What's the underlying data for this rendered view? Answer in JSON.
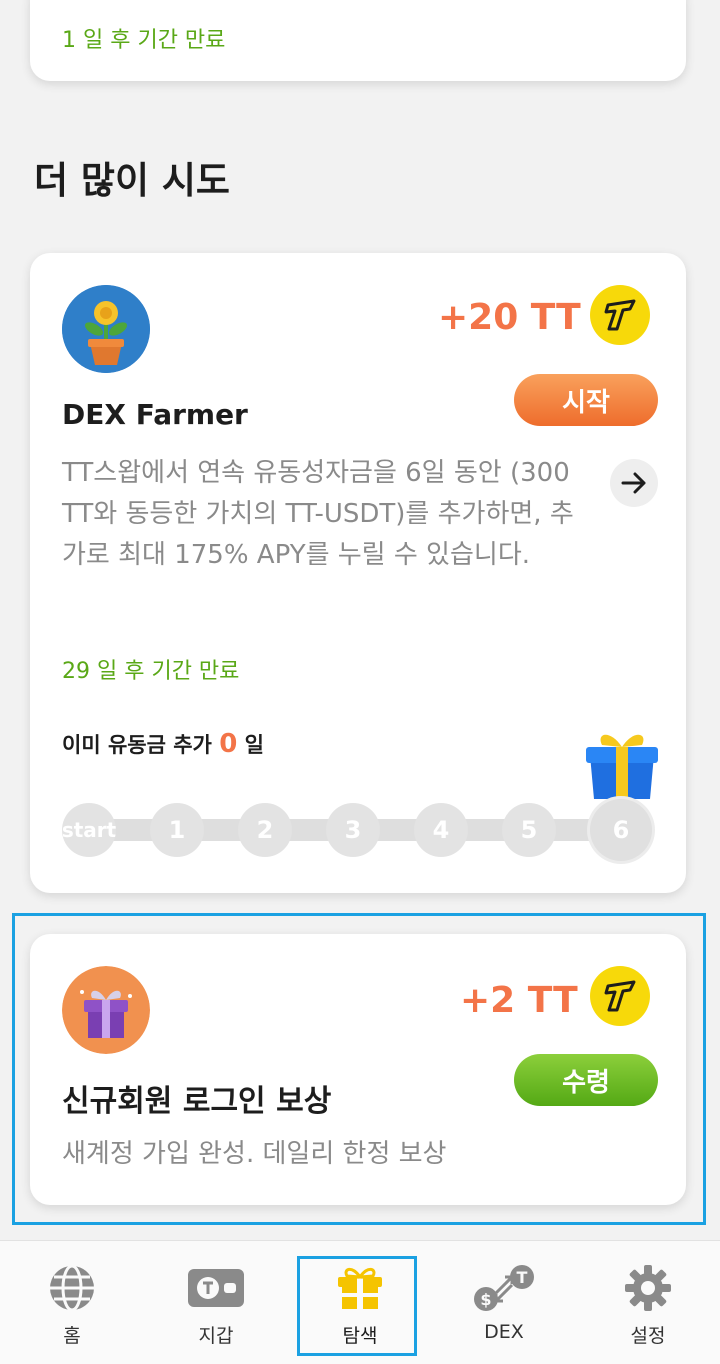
{
  "top_card": {
    "expiry": "1 일 후 기간 만료"
  },
  "section": {
    "title": "더 많이 시도"
  },
  "farmer_card": {
    "reward": "+20 TT",
    "title": "DEX Farmer",
    "action": "시작",
    "description": "TT스왑에서 연속 유동성자금을 6일 동안 (300 TT와 동등한 가치의 TT-USDT)를 추가하면, 추가로 최대 175% APY를 누릴 수 있습니다.",
    "expiry": "29 일 후 기간 만료",
    "progress_prefix": "이미 유동금 추가",
    "progress_count": "0",
    "progress_suffix": "일",
    "steps": [
      "start",
      "1",
      "2",
      "3",
      "4",
      "5",
      "6"
    ]
  },
  "login_card": {
    "reward": "+2 TT",
    "title": "신규회원 로그인 보상",
    "action": "수령",
    "description": "새계정 가입 완성. 데일리 한정 보상"
  },
  "nav": {
    "items": [
      {
        "label": "홈",
        "icon": "globe-icon"
      },
      {
        "label": "지갑",
        "icon": "wallet-icon"
      },
      {
        "label": "탐색",
        "icon": "gift-icon"
      },
      {
        "label": "DEX",
        "icon": "exchange-icon"
      },
      {
        "label": "설정",
        "icon": "gear-icon"
      }
    ],
    "active": "탐색"
  },
  "colors": {
    "accent_orange": "#f37448",
    "expiry_green": "#5aa817",
    "highlight_blue": "#1ba1e2",
    "nav_active": "#f5c400"
  }
}
